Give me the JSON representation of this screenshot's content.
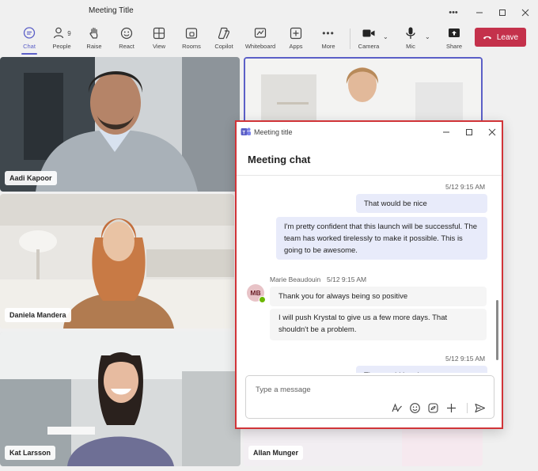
{
  "window": {
    "title": "Meeting Title",
    "controls": [
      "more",
      "minimize",
      "maximize",
      "close"
    ]
  },
  "toolbar": {
    "items": [
      {
        "label": "Chat",
        "icon": "chat-icon",
        "active": true
      },
      {
        "label": "People",
        "icon": "people-icon",
        "badge": "9"
      },
      {
        "label": "Raise",
        "icon": "hand-icon"
      },
      {
        "label": "React",
        "icon": "smiley-icon"
      },
      {
        "label": "View",
        "icon": "grid-icon"
      },
      {
        "label": "Rooms",
        "icon": "rooms-icon"
      },
      {
        "label": "Copilot",
        "icon": "copilot-icon"
      },
      {
        "label": "Whiteboard",
        "icon": "whiteboard-icon"
      },
      {
        "label": "Apps",
        "icon": "plus-box-icon"
      },
      {
        "label": "More",
        "icon": "ellipsis-icon"
      }
    ],
    "camera_label": "Camera",
    "mic_label": "Mic",
    "share_label": "Share",
    "leave_label": "Leave",
    "leave_color": "#c4314b",
    "accent_color": "#5b5fc7"
  },
  "participants": [
    {
      "name": "Aadi Kapoor"
    },
    {
      "name": "Daniela Mandera"
    },
    {
      "name": "Kat Larsson"
    },
    {
      "name": "Allan Munger"
    }
  ],
  "chat": {
    "window_title": "Meeting title",
    "heading": "Meeting chat",
    "messages": [
      {
        "from": "me",
        "time": "5/12 9:15 AM",
        "texts": [
          "That would be nice",
          "I'm pretty confident that this launch will be successful. The team has worked tirelessly to make it possible. This is going to be awesome."
        ]
      },
      {
        "from": "Marie Beaudouin",
        "initials": "MB",
        "time": "5/12 9:15 AM",
        "texts": [
          "Thank you for always being so positive",
          "I will push Krystal to give us a few more days. That shouldn't be a problem."
        ]
      },
      {
        "from": "me",
        "time": "5/12 9:15 AM",
        "texts": [
          "That would be nice"
        ]
      }
    ],
    "composer_placeholder": "Type a message",
    "composer_icons": [
      "format-icon",
      "emoji-icon",
      "loop-icon",
      "plus-icon",
      "send-icon"
    ],
    "highlight_color": "#d13438"
  }
}
